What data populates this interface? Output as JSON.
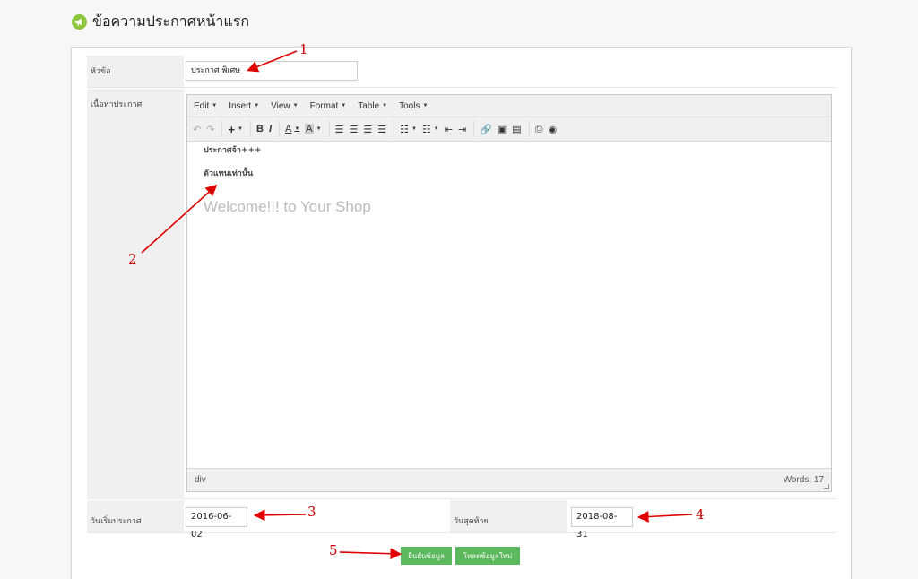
{
  "page": {
    "title": "ข้อความประกาศหน้าแรก",
    "icon": "megaphone-icon",
    "accent": "#8dc63f"
  },
  "form": {
    "title_label": "หัวข้อ",
    "title_value": "ประกาศ พิเศษ",
    "content_label": "เนื้อหาประกาศ",
    "start_label": "วันเริ่มประกาศ",
    "start_value": "2016-06-02",
    "end_label": "วันสุดท้าย",
    "end_value": "2018-08-31"
  },
  "editor": {
    "menus": [
      "Edit",
      "Insert",
      "View",
      "Format",
      "Table",
      "Tools"
    ],
    "content_lines": [
      "ประกาศจ้า+++",
      "ตัวแทนเท่านั้น"
    ],
    "welcome_text": "Welcome!!!  to Your Shop",
    "status_path": "div",
    "word_count": "Words: 17"
  },
  "buttons": {
    "confirm": "ยืนยันข้อมูล",
    "reload": "โหลดข้อมูลใหม่",
    "color": "#5cb85c"
  },
  "annotations": [
    "1",
    "2",
    "3",
    "4",
    "5"
  ],
  "annotation_color": "#cc0000"
}
